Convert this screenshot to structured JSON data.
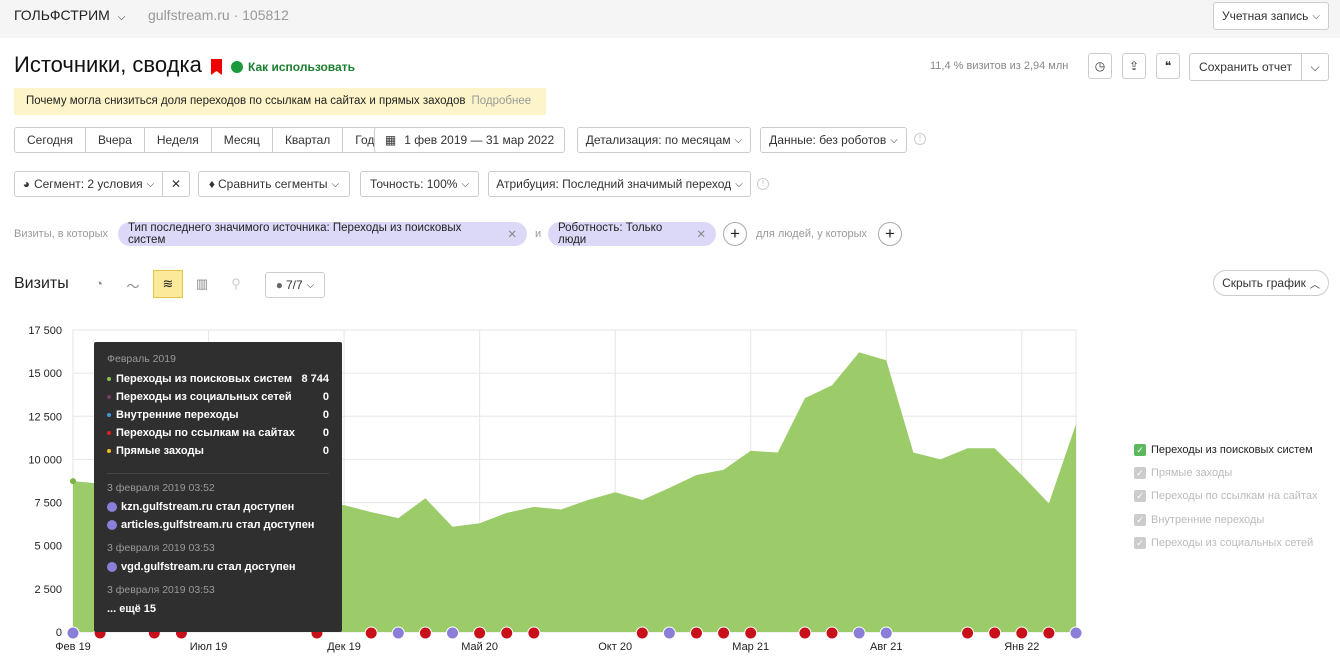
{
  "header": {
    "org": "ГОЛЬФСТРИМ",
    "site": "gulfstream.ru · 105812",
    "account": "Учетная запись"
  },
  "page": {
    "title": "Источники, сводка",
    "howto": "Как использовать",
    "stat": "11,4 % визитов из 2,94 млн",
    "save": "Сохранить отчет"
  },
  "notice": {
    "text": "Почему могла снизиться доля переходов по ссылкам на сайтах и прямых заходов",
    "more": "Подробнее"
  },
  "periods": [
    "Сегодня",
    "Вчера",
    "Неделя",
    "Месяц",
    "Квартал",
    "Год"
  ],
  "date_range": "1 фев 2019 — 31 мар 2022",
  "detail": "Детализация: по месяцам",
  "data_filter": "Данные: без роботов",
  "segment": "Сегмент: 2 условия",
  "compare": "Сравнить сегменты",
  "accuracy": "Точность: 100%",
  "attribution": "Атрибуция: Последний значимый переход",
  "filters": {
    "prefix": "Визиты, в которых",
    "chip1": "Тип последнего значимого источника: Переходы из поисковых систем",
    "and": "и",
    "chip2": "Роботность: Только люди",
    "people": "для людей, у которых"
  },
  "chart_header": {
    "title": "Визиты",
    "series_count": "7/7",
    "hide": "Скрыть график"
  },
  "tooltip": {
    "month": "Февраль 2019",
    "rows": [
      {
        "label": "Переходы из поисковых систем",
        "value": "8 744",
        "color": "#8bc34a"
      },
      {
        "label": "Переходы из социальных сетей",
        "value": "0",
        "color": "#7a3a6a"
      },
      {
        "label": "Внутренние переходы",
        "value": "0",
        "color": "#3a9ad9"
      },
      {
        "label": "Переходы по ссылкам на сайтах",
        "value": "0",
        "color": "#e02020"
      },
      {
        "label": "Прямые заходы",
        "value": "0",
        "color": "#f0c020"
      }
    ],
    "events": [
      {
        "time": "3 февраля 2019 03:52",
        "items": [
          "kzn.gulfstream.ru стал доступен",
          "articles.gulfstream.ru стал доступен"
        ]
      },
      {
        "time": "3 февраля 2019 03:53",
        "items": [
          "vgd.gulfstream.ru стал доступен"
        ]
      },
      {
        "time": "3 февраля 2019 03:53",
        "items": [
          "... ещё 15"
        ]
      }
    ]
  },
  "legend": [
    {
      "label": "Переходы из поисковых систем",
      "on": true
    },
    {
      "label": "Прямые заходы",
      "on": false
    },
    {
      "label": "Переходы по ссылкам на сайтах",
      "on": false
    },
    {
      "label": "Внутренние переходы",
      "on": false
    },
    {
      "label": "Переходы из социальных сетей",
      "on": false
    }
  ],
  "chart_data": {
    "type": "area",
    "title": "Визиты",
    "ylim": [
      0,
      17500
    ],
    "yticks": [
      "0",
      "2 500",
      "5 000",
      "7 500",
      "10 000",
      "12 500",
      "15 000",
      "17 500"
    ],
    "xticks": [
      {
        "i": 0,
        "label": "Фев 19"
      },
      {
        "i": 5,
        "label": "Июл 19"
      },
      {
        "i": 10,
        "label": "Дек 19"
      },
      {
        "i": 15,
        "label": "Май 20"
      },
      {
        "i": 20,
        "label": "Окт 20"
      },
      {
        "i": 25,
        "label": "Мар 21"
      },
      {
        "i": 30,
        "label": "Авг 21"
      },
      {
        "i": 35,
        "label": "Янв 22"
      }
    ],
    "series": [
      {
        "name": "Переходы из поисковых систем",
        "color": "#9ccc6a",
        "values": [
          8744,
          8600,
          8400,
          8200,
          8000,
          7900,
          7700,
          7600,
          7500,
          7400,
          7350,
          6950,
          6600,
          7750,
          6100,
          6300,
          6900,
          7250,
          7100,
          7650,
          8100,
          7650,
          8350,
          9100,
          9400,
          10500,
          10400,
          13550,
          14300,
          16200,
          15750,
          10400,
          10000,
          10650,
          10650,
          9100,
          7450,
          12050
        ]
      }
    ],
    "annotations": [
      {
        "i": 0,
        "type": "site"
      },
      {
        "i": 1,
        "type": "yandex"
      },
      {
        "i": 3,
        "type": "yandex"
      },
      {
        "i": 4,
        "type": "yandex"
      },
      {
        "i": 9,
        "type": "yandex"
      },
      {
        "i": 11,
        "type": "yandex"
      },
      {
        "i": 12,
        "type": "site"
      },
      {
        "i": 13,
        "type": "yandex"
      },
      {
        "i": 14,
        "type": "site"
      },
      {
        "i": 15,
        "type": "yandex"
      },
      {
        "i": 16,
        "type": "yandex"
      },
      {
        "i": 17,
        "type": "yandex"
      },
      {
        "i": 21,
        "type": "yandex"
      },
      {
        "i": 22,
        "type": "site"
      },
      {
        "i": 23,
        "type": "yandex"
      },
      {
        "i": 24,
        "type": "yandex"
      },
      {
        "i": 25,
        "type": "yandex"
      },
      {
        "i": 27,
        "type": "yandex"
      },
      {
        "i": 28,
        "type": "yandex"
      },
      {
        "i": 29,
        "type": "site"
      },
      {
        "i": 30,
        "type": "site"
      },
      {
        "i": 33,
        "type": "yandex"
      },
      {
        "i": 34,
        "type": "yandex"
      },
      {
        "i": 35,
        "type": "yandex"
      },
      {
        "i": 36,
        "type": "yandex"
      },
      {
        "i": 37,
        "type": "site"
      }
    ]
  }
}
